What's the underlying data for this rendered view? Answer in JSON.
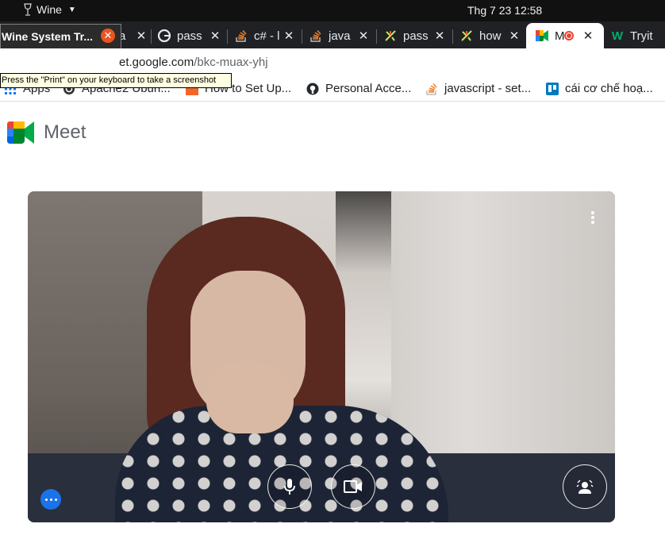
{
  "topbar": {
    "app_name": "Wine",
    "clock": "Thg 7 23  12:58"
  },
  "tabs": [
    {
      "title": "a",
      "icon": "generic-icon"
    },
    {
      "title": "pass",
      "icon": "google-icon"
    },
    {
      "title": "c# - l",
      "icon": "stackoverflow-icon"
    },
    {
      "title": "java",
      "icon": "stackoverflow-icon"
    },
    {
      "title": "pass",
      "icon": "pass-icon"
    },
    {
      "title": "how",
      "icon": "pass-icon"
    },
    {
      "title": "M",
      "icon": "meet-icon",
      "recording": true
    },
    {
      "title": "Tryit",
      "icon": "w3schools-icon"
    }
  ],
  "wine_window": {
    "title": "Wine System Tr..."
  },
  "address": {
    "host": "et.google.com",
    "path": "/bkc-muax-yhj"
  },
  "tooltip": "Press the \"Print\" on your keyboard to take a screenshot",
  "bookmarks": [
    {
      "label": "Apps",
      "icon": "apps-grid-icon"
    },
    {
      "label": "Apache2 Ubun...",
      "icon": "ubuntu-icon"
    },
    {
      "label": "How to Set Up...",
      "icon": "html-icon"
    },
    {
      "label": "Personal Acce...",
      "icon": "github-icon"
    },
    {
      "label": "javascript - set...",
      "icon": "stackoverflow-icon"
    },
    {
      "label": "cái cơ chế hoạ...",
      "icon": "trello-icon"
    }
  ],
  "meet": {
    "brand": "Meet"
  },
  "colors": {
    "meet_blue": "#1a73e8",
    "tab_strip": "#202124",
    "wine_close": "#e95420"
  }
}
